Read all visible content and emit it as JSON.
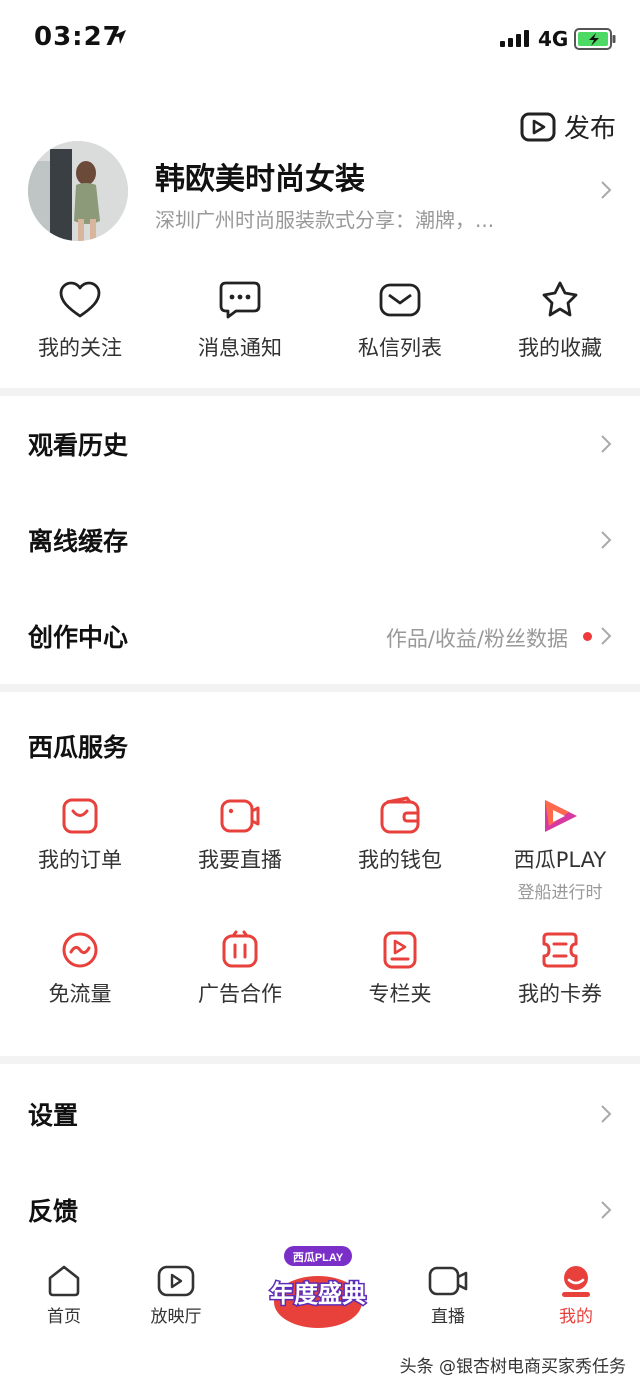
{
  "status": {
    "time": "03:27",
    "network": "4G"
  },
  "publish": {
    "label": "发布"
  },
  "profile": {
    "name": "韩欧美时尚女装",
    "description": "深圳广州时尚服装款式分享：潮牌，..."
  },
  "quick_actions": [
    {
      "label": "我的关注",
      "icon": "heart-icon"
    },
    {
      "label": "消息通知",
      "icon": "chat-bubble-icon"
    },
    {
      "label": "私信列表",
      "icon": "envelope-icon"
    },
    {
      "label": "我的收藏",
      "icon": "star-icon"
    }
  ],
  "menu": [
    {
      "label": "观看历史"
    },
    {
      "label": "离线缓存"
    },
    {
      "label": "创作中心",
      "sub": "作品/收益/粉丝数据"
    }
  ],
  "services": {
    "title": "西瓜服务",
    "items": [
      {
        "label": "我的订单",
        "icon": "order-bag-icon"
      },
      {
        "label": "我要直播",
        "icon": "live-camera-icon"
      },
      {
        "label": "我的钱包",
        "icon": "wallet-icon"
      },
      {
        "label": "西瓜PLAY",
        "sub": "登船进行时",
        "icon": "xigua-play-icon"
      },
      {
        "label": "免流量",
        "icon": "free-data-icon"
      },
      {
        "label": "广告合作",
        "icon": "ad-cooperation-icon"
      },
      {
        "label": "专栏夹",
        "icon": "column-folder-icon"
      },
      {
        "label": "我的卡券",
        "icon": "coupon-icon"
      }
    ]
  },
  "settings": [
    {
      "label": "设置"
    },
    {
      "label": "反馈"
    }
  ],
  "tabbar": {
    "tabs": [
      {
        "label": "首页",
        "icon": "home-icon"
      },
      {
        "label": "放映厅",
        "icon": "theater-play-icon"
      },
      {
        "label": "直播",
        "icon": "video-camera-icon"
      },
      {
        "label": "我的",
        "icon": "profile-icon",
        "active": true
      }
    ],
    "promo": {
      "top": "西瓜PLAY",
      "main": "年度盛典"
    }
  },
  "watermark": "头条 @银杏树电商买家秀任务",
  "colors": {
    "accent": "#e8413c",
    "text": "#222222",
    "secondary": "#999999",
    "separator": "#f3f3f3"
  }
}
